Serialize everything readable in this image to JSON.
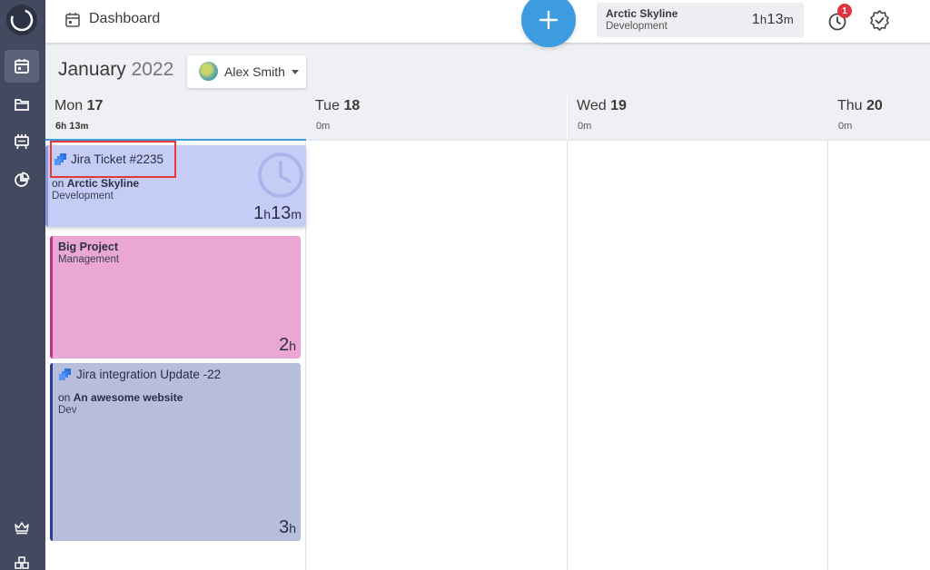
{
  "header": {
    "title": "Dashboard",
    "running_timer": {
      "project": "Arctic Skyline",
      "task": "Development",
      "duration_num1": "1",
      "duration_unit1": "h",
      "duration_num2": "13",
      "duration_unit2": "m"
    },
    "notification_count": "1"
  },
  "toolbar": {
    "month": "January",
    "year": "2022",
    "user_name": "Alex Smith"
  },
  "days": [
    {
      "weekday": "Mon",
      "date": "17",
      "total_num1": "6",
      "total_unit1": "h",
      "total_num2": "13",
      "total_unit2": "m"
    },
    {
      "weekday": "Tue",
      "date": "18",
      "total": "0m"
    },
    {
      "weekday": "Wed",
      "date": "19",
      "total": "0m"
    },
    {
      "weekday": "Thu",
      "date": "20",
      "total": "0m"
    }
  ],
  "entries": [
    {
      "title": "Jira Ticket #2235",
      "prefix": "on",
      "project": "Arctic Skyline",
      "task": "Development",
      "dur_num1": "1",
      "dur_unit1": "h",
      "dur_num2": "13",
      "dur_unit2": "m",
      "color": "#c5cdf6",
      "accent": "#8c97e0"
    },
    {
      "title": "Big Project",
      "task": "Management",
      "dur_num": "2",
      "dur_unit": "h",
      "color": "#eaa7d3",
      "accent": "#c2338e"
    },
    {
      "title": "Jira integration Update -22",
      "prefix": "on",
      "project": "An awesome website",
      "task": "Dev",
      "dur_num": "3",
      "dur_unit": "h",
      "color": "#b6bedc",
      "accent": "#2c3e92"
    }
  ],
  "icons": {
    "sidebar": [
      "calendar-icon",
      "folder-icon",
      "projects-board-icon",
      "reports-pie-icon",
      "crown-icon",
      "integrations-icon"
    ],
    "topbar": [
      "calendar-icon",
      "plus-icon",
      "history-clock-icon",
      "approve-check-icon"
    ]
  },
  "colors": {
    "accent": "#3d9bdf",
    "sidebar": "#434a5f",
    "badge": "#e1343f"
  }
}
